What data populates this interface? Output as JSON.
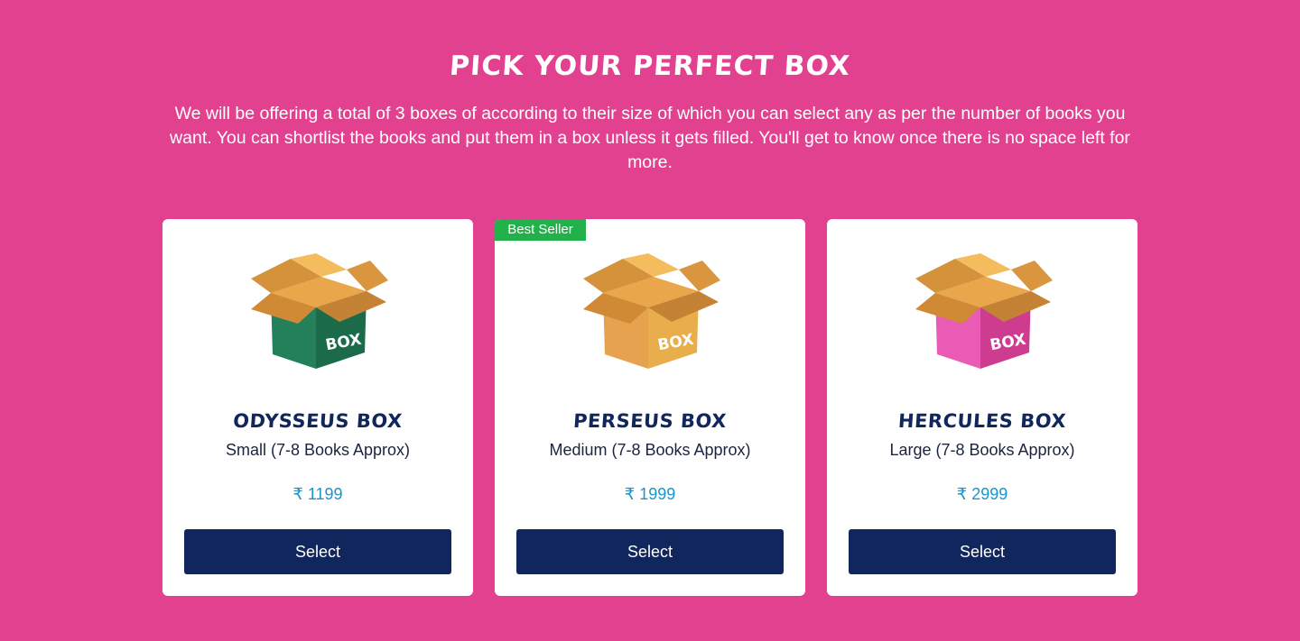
{
  "section": {
    "title": "PICK YOUR PERFECT BOX",
    "description": "We will be offering a total of 3 boxes of according to their size of which you can select any as per the number of books you want. You can shortlist the books and put them in a box unless it gets filled. You'll get to know once there is no space left for more."
  },
  "cards": [
    {
      "name": "ODYSSEUS BOX",
      "size": "Small (7-8 Books Approx)",
      "price": "₹ 1199",
      "button": "Select",
      "box_label": "BOX",
      "box_color": "#23805a",
      "box_color_dark": "#1b6a49"
    },
    {
      "badge": "Best Seller",
      "name": "PERSEUS BOX",
      "size": "Medium (7-8 Books Approx)",
      "price": "₹ 1999",
      "button": "Select",
      "box_label": "BOX",
      "box_color": "#e6a24e",
      "box_color_dark": "#d9953f"
    },
    {
      "name": "HERCULES BOX",
      "size": "Large (7-8 Books Approx)",
      "price": "₹ 2999",
      "button": "Select",
      "box_label": "BOX",
      "box_color": "#e95bb4",
      "box_color_dark": "#cd3c8f"
    }
  ],
  "colors": {
    "background": "#e2418f",
    "button": "#11265c",
    "price": "#1e93c9",
    "badge": "#22b04b"
  }
}
